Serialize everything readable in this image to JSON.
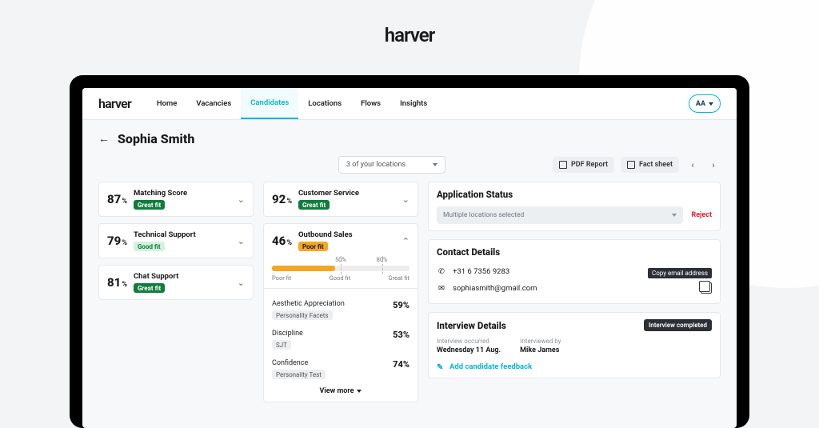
{
  "page_brand": "harver",
  "nav": {
    "brand": "harver",
    "items": [
      "Home",
      "Vacancies",
      "Candidates",
      "Locations",
      "Flows",
      "Insights"
    ],
    "active_index": 2,
    "user_initials": "AA"
  },
  "header": {
    "back_glyph": "←",
    "title": "Sophia Smith"
  },
  "toolbar": {
    "locations_label": "3 of your locations",
    "pdf_report": "PDF Report",
    "fact_sheet": "Fact sheet"
  },
  "score_cards_a": [
    {
      "value": "87",
      "pct": "%",
      "label": "Matching Score",
      "fit": "Great fit",
      "fit_class": "great"
    },
    {
      "value": "79",
      "pct": "%",
      "label": "Technical Support",
      "fit": "Good fit",
      "fit_class": "good"
    },
    {
      "value": "81",
      "pct": "%",
      "label": "Chat Support",
      "fit": "Great fit",
      "fit_class": "great"
    }
  ],
  "score_cards_b": [
    {
      "value": "92",
      "pct": "%",
      "label": "Customer Service",
      "fit": "Great fit",
      "fit_class": "great",
      "expanded": false
    },
    {
      "value": "46",
      "pct": "%",
      "label": "Outbound Sales",
      "fit": "Poor fit",
      "fit_class": "poor",
      "expanded": true
    }
  ],
  "outbound": {
    "bar_fill_pct": 46,
    "tick1": {
      "pos": 50,
      "label": "50%"
    },
    "tick2": {
      "pos": 80,
      "label": "80%"
    },
    "legend": {
      "poor": "Poor fit",
      "good": "Good fit",
      "great": "Great fit"
    },
    "facets": [
      {
        "title": "Aesthetic Appreciation",
        "tag": "Personality Facets",
        "value": "59%"
      },
      {
        "title": "Discipline",
        "tag": "SJT",
        "value": "53%"
      },
      {
        "title": "Confidence",
        "tag": "Personailty Test",
        "value": "74%"
      }
    ],
    "view_more": "View more"
  },
  "right": {
    "status": {
      "title": "Application Status",
      "select_label": "Multiple locations selected",
      "reject": "Reject"
    },
    "contact": {
      "title": "Contact Details",
      "phone": "+31 6 7356 9283",
      "email": "sophiasmith@gmail.com",
      "copy_tooltip": "Copy email address"
    },
    "interview": {
      "title": "Interview Details",
      "chip": "Interview completed",
      "occurred_label": "Interview occurred",
      "occurred_value": "Wednesday 11 Aug.",
      "by_label": "Interviewed by",
      "by_value": "Mike James",
      "add_feedback": "Add candidate feedback"
    }
  }
}
